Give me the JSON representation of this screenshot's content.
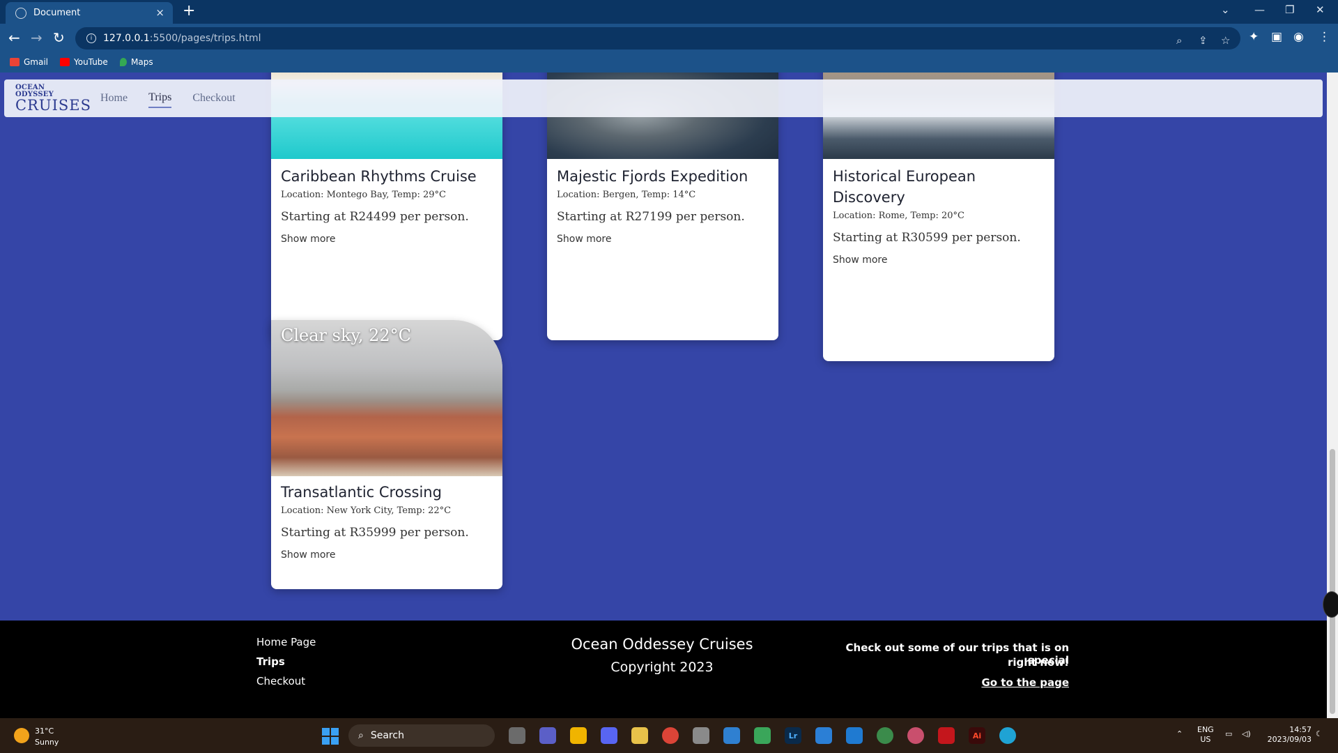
{
  "browser": {
    "tab_title": "Document",
    "tab_close": "×",
    "new_tab": "+",
    "url_host": "127.0.0.1",
    "url_path": ":5500/pages/trips.html",
    "bookmarks": [
      {
        "label": "Gmail",
        "color": "#ea4335"
      },
      {
        "label": "YouTube",
        "color": "#ff0000"
      },
      {
        "label": "Maps",
        "color": "#34a853"
      }
    ]
  },
  "site_nav": {
    "logo_line1": "OCEAN ODYSSEY",
    "logo_line2": "CRUISES",
    "links": [
      "Home",
      "Trips",
      "Checkout"
    ],
    "active": "Trips"
  },
  "cards": [
    {
      "title": "Caribbean Rhythms Cruise",
      "location": "Location: Montego Bay, Temp: 29°C",
      "price": "Starting at R24499 per person.",
      "more": "Show more"
    },
    {
      "title": "Majestic Fjords Expedition",
      "location": "Location: Bergen, Temp: 14°C",
      "price": "Starting at R27199 per person.",
      "more": "Show more"
    },
    {
      "title": "Historical European Discovery",
      "location": "Location: Rome, Temp: 20°C",
      "price": "Starting at R30599 per person.",
      "more": "Show more"
    },
    {
      "title": "Transatlantic Crossing",
      "location": "Location: New York City, Temp: 22°C",
      "price": "Starting at R35999 per person.",
      "more": "Show more",
      "weather": "Clear sky, 22°C"
    }
  ],
  "footer": {
    "links": [
      "Home Page",
      "Trips",
      "Checkout"
    ],
    "active_link": "Trips",
    "brand": "Ocean Oddessey Cruises",
    "copyright": "Copyright 2023",
    "promo_line1": "Check out some of our trips that is on special",
    "promo_line2": "right now!",
    "go_link": "Go to the page"
  },
  "taskbar": {
    "temp": "31°C",
    "condition": "Sunny",
    "search": "Search",
    "lang_line1": "ENG",
    "lang_line2": "US",
    "time": "14:57",
    "date": "2023/09/03"
  }
}
